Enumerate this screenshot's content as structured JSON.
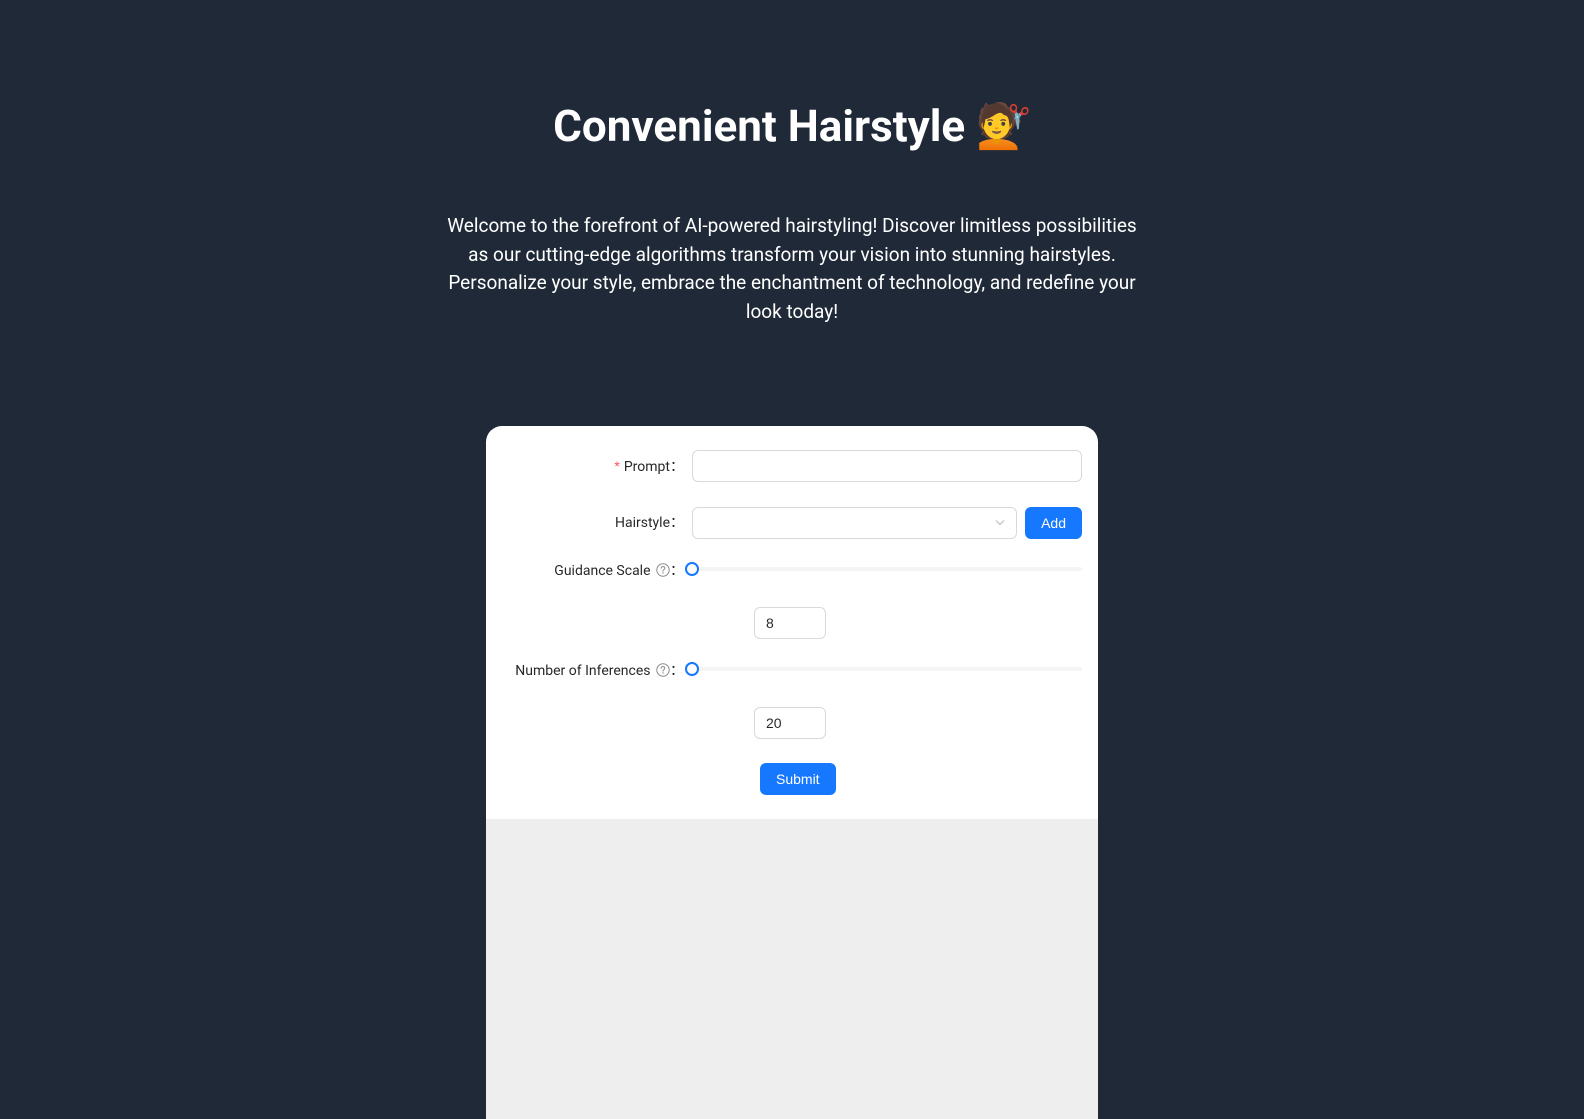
{
  "header": {
    "title": "Convenient Hairstyle  💇",
    "description": "Welcome to the forefront of AI-powered hairstyling! Discover limitless possibilities as our cutting-edge algorithms transform your vision into stunning hairstyles. Personalize your style, embrace the enchantment of technology, and redefine your look today!"
  },
  "form": {
    "prompt": {
      "label": "Prompt",
      "value": ""
    },
    "hairstyle": {
      "label": "Hairstyle",
      "add_button": "Add",
      "value": ""
    },
    "guidance_scale": {
      "label": "Guidance Scale",
      "value": "8"
    },
    "num_inferences": {
      "label": "Number of Inferences",
      "value": "20"
    },
    "submit_label": "Submit"
  }
}
